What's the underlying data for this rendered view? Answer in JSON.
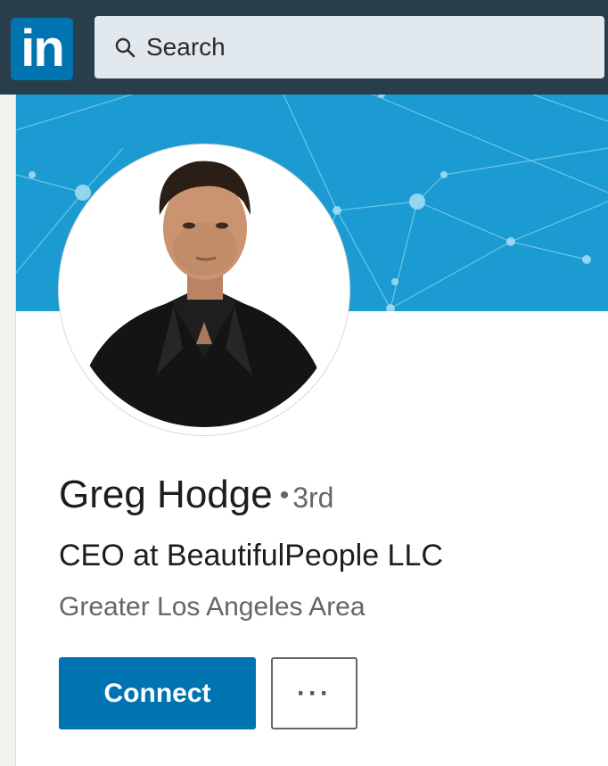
{
  "nav": {
    "logo_text": "in",
    "search_placeholder": "Search",
    "colors": {
      "nav_bg": "#283e4a",
      "logo_bg": "#0073b1",
      "search_bg": "#e1e9ee"
    }
  },
  "profile": {
    "name": "Greg Hodge",
    "separator": "•",
    "degree": "3rd",
    "headline": "CEO at BeautifulPeople LLC",
    "location": "Greater Los Angeles Area"
  },
  "actions": {
    "connect_label": "Connect",
    "more_label": "···"
  },
  "icons": [
    "search-icon",
    "more-icon"
  ],
  "colors": {
    "banner": "#1b9bd1",
    "primary_button": "#0073b1"
  }
}
